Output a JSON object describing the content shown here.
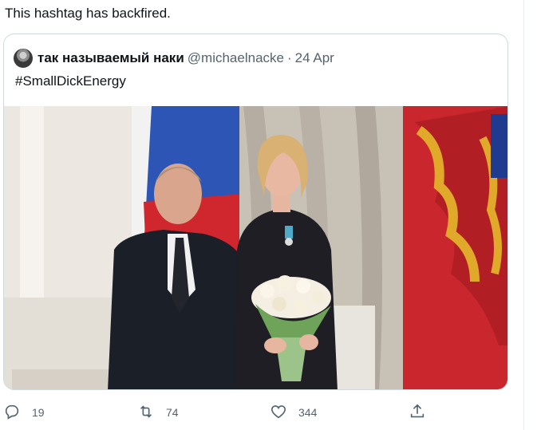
{
  "tweet": {
    "text": "This hashtag has backfired."
  },
  "quoted_tweet": {
    "author_name": "так называемый наки",
    "handle": "@michaelnacke",
    "separator": "·",
    "date": "24 Apr",
    "text": "#SmallDickEnergy"
  },
  "actions": {
    "reply_count": "19",
    "retweet_count": "74",
    "like_count": "344"
  },
  "icons": {
    "reply": "reply-icon",
    "retweet": "retweet-icon",
    "like": "heart-icon",
    "share": "share-icon"
  },
  "colors": {
    "text_primary": "#0f1419",
    "text_secondary": "#536471",
    "border": "#cfd9de"
  }
}
